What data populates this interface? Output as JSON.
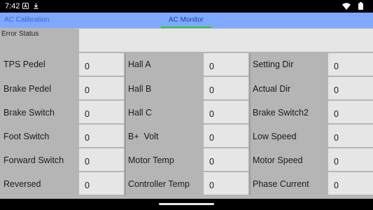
{
  "status_bar": {
    "time": "7:42"
  },
  "tabs": [
    {
      "label": "AC Calibration"
    },
    {
      "label": "AC Monitor"
    }
  ],
  "error_status": {
    "label": "Error Status",
    "value": ""
  },
  "col1": [
    {
      "label": "TPS Pedel",
      "value": "0"
    },
    {
      "label": "Brake Pedel",
      "value": "0"
    },
    {
      "label": "Brake Switch",
      "value": "0"
    },
    {
      "label": "Foot Switch",
      "value": "0"
    },
    {
      "label": "Forward Switch",
      "value": "0"
    },
    {
      "label": "Reversed",
      "value": "0"
    }
  ],
  "col2": [
    {
      "label": "Hall A",
      "value": "0"
    },
    {
      "label": "Hall B",
      "value": "0"
    },
    {
      "label": "Hall C",
      "value": "0"
    },
    {
      "label": "B+  Volt",
      "value": "0"
    },
    {
      "label": "Motor Temp",
      "value": "0"
    },
    {
      "label": "Controller Temp",
      "value": "0"
    }
  ],
  "col3": [
    {
      "label": "Setting Dir",
      "value": "0"
    },
    {
      "label": "Actual Dir",
      "value": "0"
    },
    {
      "label": "Brake Switch2",
      "value": "0"
    },
    {
      "label": "Low Speed",
      "value": "0"
    },
    {
      "label": "Motor Speed",
      "value": "0"
    },
    {
      "label": "Phase Current",
      "value": "0"
    }
  ]
}
